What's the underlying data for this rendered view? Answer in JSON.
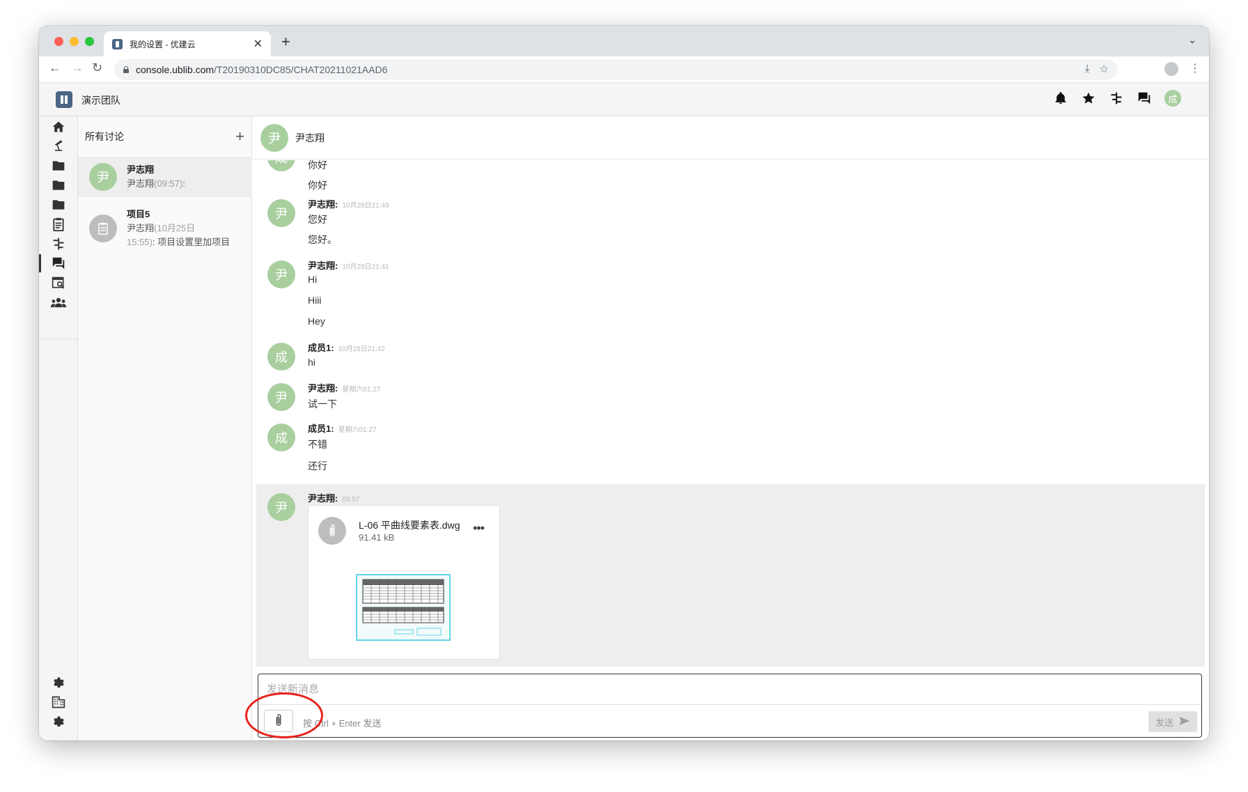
{
  "browser": {
    "tab_title": "我的设置 - 优建云",
    "url_host": "console.ublib.com",
    "url_path": "/T20190310DC85/CHAT20211021AAD6",
    "traffic_light_colors": [
      "#ff5f57",
      "#febc2e",
      "#28c840"
    ]
  },
  "app": {
    "team_name": "演示团队",
    "user_avatar": "成",
    "header_icons": [
      "bell-icon",
      "star-icon",
      "gantt-icon",
      "chat-icon"
    ]
  },
  "rail": {
    "items": [
      "home-icon",
      "lamp-icon",
      "folder-icon",
      "folder-icon",
      "folder-icon",
      "clipboard-icon",
      "gantt-icon",
      "chat-icon",
      "search-doc-icon",
      "team-icon"
    ],
    "active_index": 7,
    "bottom_items": [
      "gear-icon",
      "building-icon",
      "gear-icon"
    ]
  },
  "discussions": {
    "title": "所有讨论",
    "items": [
      {
        "avatar": "尹",
        "name": "尹志翔",
        "sub_name": "尹志翔",
        "sub_time": "(09:57)",
        "sub_rest": ":",
        "selected": true
      },
      {
        "avatar": "clipboard-icon",
        "name": "项目5",
        "sub_name": "尹志翔",
        "sub_time": "(10月25日",
        "sub_time2": "15:55)",
        "sub_rest": ": 项目设置里加项目",
        "selected": false
      }
    ]
  },
  "chat": {
    "title": "尹志翔",
    "avatar": "尹",
    "messages": [
      {
        "avatar": "成",
        "lines": [
          "你好",
          "你好"
        ]
      },
      {
        "avatar": "尹",
        "author": "尹志翔:",
        "time": "10月28日21:49",
        "lines": [
          "您好",
          "您好。"
        ]
      },
      {
        "avatar": "尹",
        "author": "尹志翔:",
        "time": "10月29日21:41",
        "lines": [
          "Hi",
          "Hiii",
          "Hey"
        ]
      },
      {
        "avatar": "成",
        "author": "成员1:",
        "time": "10月29日21:42",
        "lines": [
          "hi"
        ]
      },
      {
        "avatar": "尹",
        "author": "尹志翔:",
        "time": "星期六01:27",
        "lines": [
          "试一下"
        ]
      },
      {
        "avatar": "成",
        "author": "成员1:",
        "time": "星期六01:27",
        "lines": [
          "不错",
          "还行"
        ]
      },
      {
        "avatar": "尹",
        "author": "尹志翔:",
        "time": "09:57",
        "file": {
          "name": "L-06 平曲线要素表.dwg",
          "size": "91.41 kB"
        }
      }
    ],
    "composer": {
      "placeholder": "发送新消息",
      "hint": "按 Ctrl + Enter 发送",
      "send_label": "发送"
    }
  },
  "colors": {
    "avatar_green": "#a9cf9f",
    "highlight_circle": "#e8221b"
  }
}
